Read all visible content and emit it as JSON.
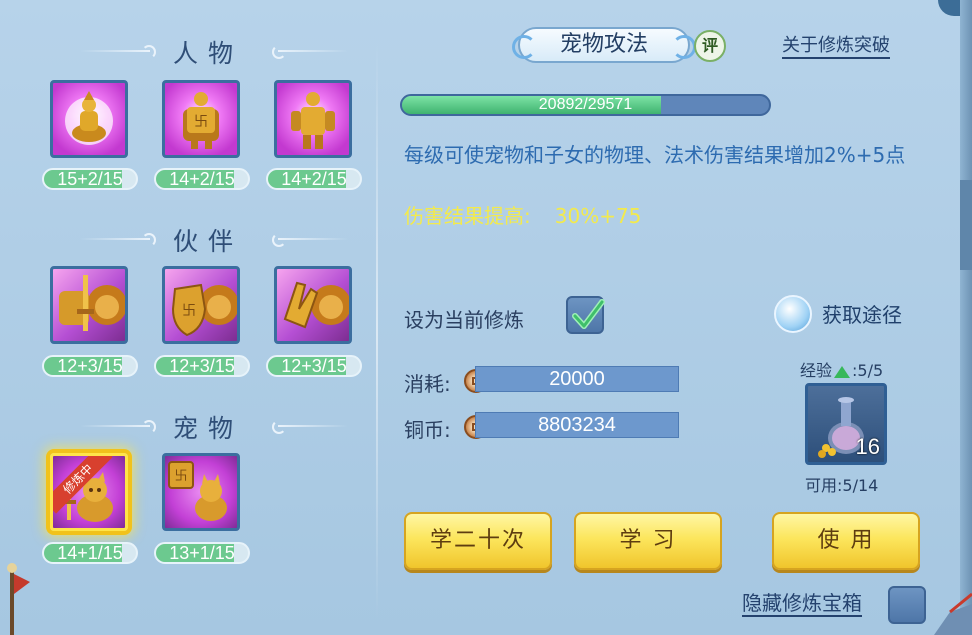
{
  "left": {
    "sections": [
      {
        "title": "人物",
        "skills": [
          {
            "name": "persona-skill-1",
            "level": "15+2/15",
            "icon": "golden-buddha-icon"
          },
          {
            "name": "persona-skill-2",
            "level": "14+2/15",
            "icon": "golden-armor-shield-icon"
          },
          {
            "name": "persona-skill-3",
            "level": "14+2/15",
            "icon": "golden-armor-icon"
          }
        ]
      },
      {
        "title": "伙伴",
        "skills": [
          {
            "name": "partner-skill-1",
            "level": "12+3/15",
            "icon": "lion-sword-icon"
          },
          {
            "name": "partner-skill-2",
            "level": "12+3/15",
            "icon": "lion-shield-icon"
          },
          {
            "name": "partner-skill-3",
            "level": "12+3/15",
            "icon": "lion-gauntlet-icon"
          }
        ]
      },
      {
        "title": "宠物",
        "skills": [
          {
            "name": "pet-skill-1",
            "level": "14+1/15",
            "icon": "pet-cat-sword-icon",
            "badge": "修炼中",
            "selected": true
          },
          {
            "name": "pet-skill-2",
            "level": "13+1/15",
            "icon": "pet-cat-shield-icon"
          }
        ]
      }
    ]
  },
  "header": {
    "title": "宠物攻法",
    "rate_badge": "评",
    "about_link": "关于修炼突破"
  },
  "progress": {
    "current": 20892,
    "max": 29571,
    "text": "20892/29571",
    "fraction": 0.7065
  },
  "description": "每级可使宠物和子女的物理、法术伤害结果增加2%+5点",
  "effect": {
    "label": "伤害结果提高:",
    "value": "30%+75"
  },
  "set_current": {
    "label": "设为当前修炼",
    "checked": true
  },
  "obtain": {
    "label": "获取途径",
    "icon": "book-icon"
  },
  "cost": {
    "label": "消耗:",
    "value": "20000"
  },
  "copper": {
    "label": "铜币:",
    "value": "8803234"
  },
  "exp": {
    "prefix": "经验",
    "value": ":5/5"
  },
  "item": {
    "icon": "potion-vase-with-coins-icon",
    "count": "16"
  },
  "available": "可用:5/14",
  "buttons": {
    "learn_twenty": "学二十次",
    "learn": "学 习",
    "use": "使 用"
  },
  "hide_chest": {
    "label": "隐藏修炼宝箱",
    "checked": false
  },
  "colors": {
    "panel_bg": "#a6c7e1",
    "progress_fill": "#3fb36f",
    "description_text": "#2d6bb0",
    "effect_text": "#f3ea4c",
    "button_gold": "#fce65d",
    "selected_glow": "#ffe44a"
  }
}
